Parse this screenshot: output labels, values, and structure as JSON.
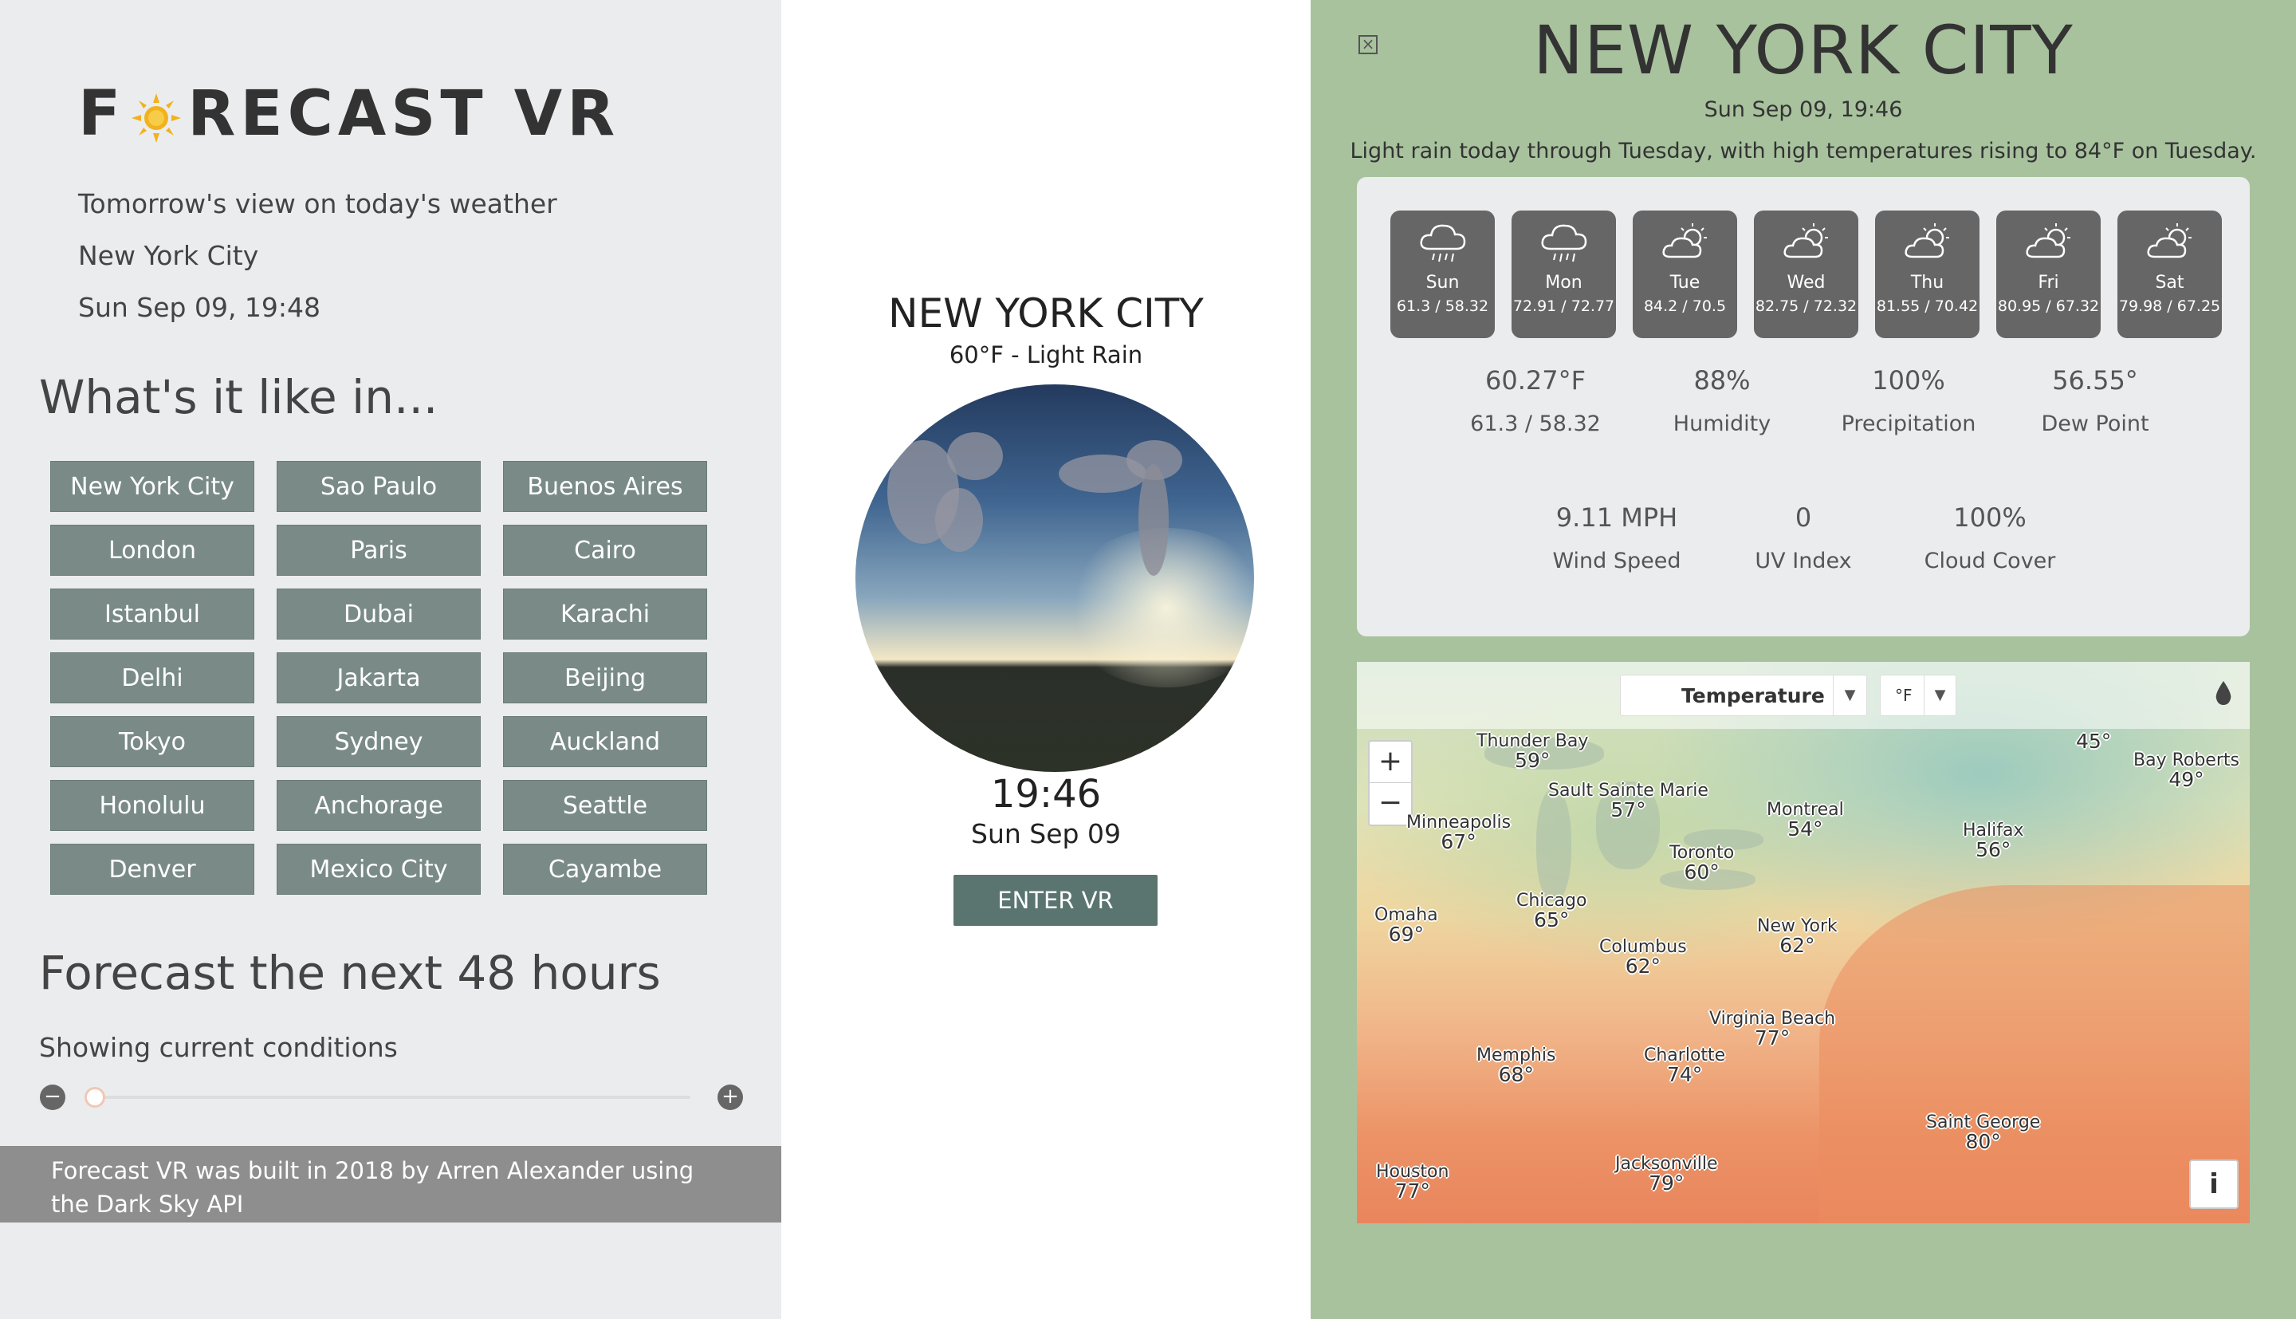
{
  "app": {
    "logo_text_a": "F",
    "logo_text_b": "RECAST VR",
    "tagline": "Tomorrow's view on today's weather",
    "current_city": "New York City",
    "current_datetime": "Sun Sep 09, 19:48"
  },
  "cities_heading": "What's it like in...",
  "cities": [
    "New York City",
    "Sao Paulo",
    "Buenos Aires",
    "London",
    "Paris",
    "Cairo",
    "Istanbul",
    "Dubai",
    "Karachi",
    "Delhi",
    "Jakarta",
    "Beijing",
    "Tokyo",
    "Sydney",
    "Auckland",
    "Honolulu",
    "Anchorage",
    "Seattle",
    "Denver",
    "Mexico City",
    "Cayambe"
  ],
  "forecast": {
    "heading": "Forecast the next 48 hours",
    "status": "Showing current conditions",
    "slider_value": 0,
    "minus_icon": "minus-circle-icon",
    "plus_icon": "plus-circle-icon"
  },
  "footer": "Forecast VR was built in 2018 by Arren Alexander using the Dark Sky API",
  "vr_view": {
    "title": "NEW YORK CITY",
    "subtitle": "60°F - Light Rain",
    "time": "19:46",
    "date": "Sun Sep 09",
    "enter_button": "ENTER VR"
  },
  "detail": {
    "title": "NEW YORK CITY",
    "date": "Sun Sep 09, 19:46",
    "summary": "Light rain today through Tuesday, with high temperatures rising to 84°F on Tuesday.",
    "days": [
      {
        "name": "Sun",
        "temp": "61.3 / 58.32",
        "icon": "rain-icon"
      },
      {
        "name": "Mon",
        "temp": "72.91 / 72.77",
        "icon": "rain-icon"
      },
      {
        "name": "Tue",
        "temp": "84.2 / 70.5",
        "icon": "partly-cloudy-icon"
      },
      {
        "name": "Wed",
        "temp": "82.75 / 72.32",
        "icon": "partly-cloudy-icon"
      },
      {
        "name": "Thu",
        "temp": "81.55 / 70.42",
        "icon": "partly-cloudy-icon"
      },
      {
        "name": "Fri",
        "temp": "80.95 / 67.32",
        "icon": "partly-cloudy-icon"
      },
      {
        "name": "Sat",
        "temp": "79.98 / 67.25",
        "icon": "partly-cloudy-icon"
      }
    ],
    "stats_row1": [
      {
        "value": "60.27°F",
        "label": "61.3 / 58.32"
      },
      {
        "value": "88%",
        "label": "Humidity"
      },
      {
        "value": "100%",
        "label": "Precipitation"
      },
      {
        "value": "56.55°",
        "label": "Dew Point"
      }
    ],
    "stats_row2": [
      {
        "value": "9.11 MPH",
        "label": "Wind Speed"
      },
      {
        "value": "0",
        "label": "UV Index"
      },
      {
        "value": "100%",
        "label": "Cloud Cover"
      }
    ]
  },
  "map": {
    "layer": "Temperature",
    "unit": "°F",
    "zoom_in": "+",
    "zoom_out": "−",
    "info": "i",
    "cities": [
      {
        "name": "Thunder Bay",
        "temp": "59°"
      },
      {
        "name": "Sault Sainte Marie",
        "temp": "57°"
      },
      {
        "name": "Minneapolis",
        "temp": "67°"
      },
      {
        "name": "Montreal",
        "temp": "54°"
      },
      {
        "name": "Toronto",
        "temp": "60°"
      },
      {
        "name": "Halifax",
        "temp": "56°"
      },
      {
        "name": "Bay Roberts",
        "temp": "49°"
      },
      {
        "name": "",
        "temp": "45°"
      },
      {
        "name": "Omaha",
        "temp": "69°"
      },
      {
        "name": "Chicago",
        "temp": "65°"
      },
      {
        "name": "Columbus",
        "temp": "62°"
      },
      {
        "name": "New York",
        "temp": "62°"
      },
      {
        "name": "Virginia Beach",
        "temp": "77°"
      },
      {
        "name": "Memphis",
        "temp": "68°"
      },
      {
        "name": "Charlotte",
        "temp": "74°"
      },
      {
        "name": "Saint George",
        "temp": "80°"
      },
      {
        "name": "Houston",
        "temp": "77°"
      },
      {
        "name": "Jacksonville",
        "temp": "79°"
      }
    ]
  }
}
